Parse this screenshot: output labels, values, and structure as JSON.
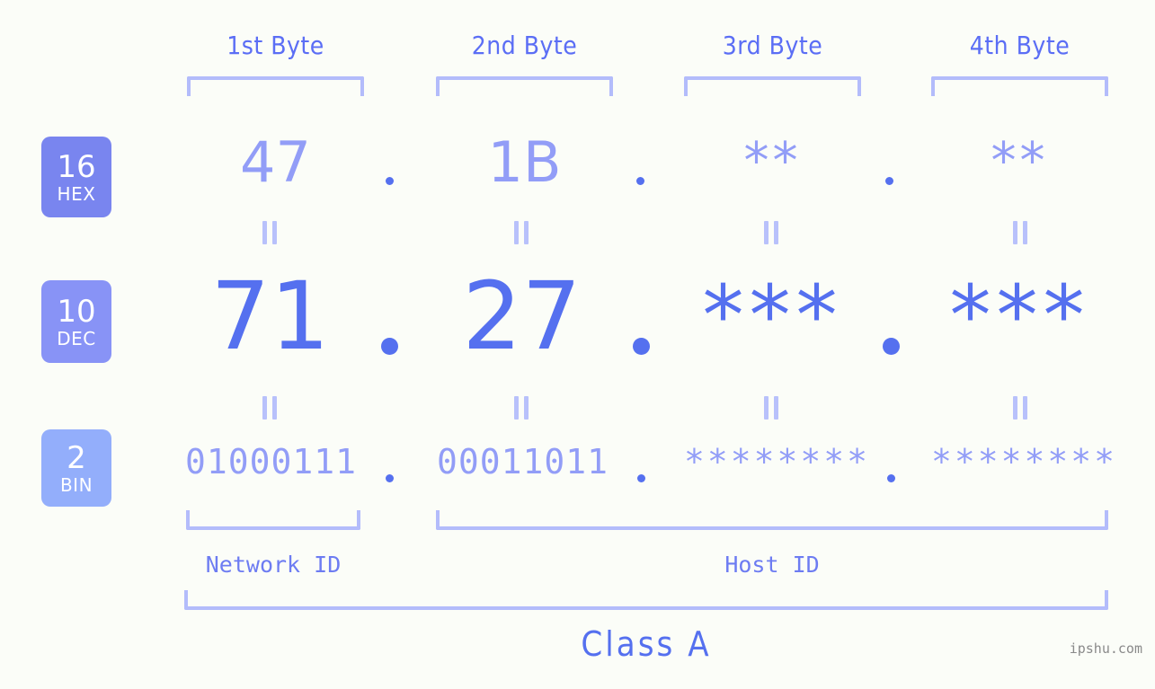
{
  "background_color": "#fbfdf8",
  "accent_color": "#5570ef",
  "accent_light": "#929df7",
  "bracket_color": "#b3bcfb",
  "byte_headers": [
    {
      "label": "1st Byte"
    },
    {
      "label": "2nd Byte"
    },
    {
      "label": "3rd Byte"
    },
    {
      "label": "4th Byte"
    }
  ],
  "bases": [
    {
      "number": "16",
      "word": "HEX",
      "color": "#7985ef"
    },
    {
      "number": "10",
      "word": "DEC",
      "color": "#8893f6"
    },
    {
      "number": "2",
      "word": "BIN",
      "color": "#93aefb"
    }
  ],
  "rows": {
    "hex": {
      "byte1": "47",
      "byte2": "1B",
      "byte3": "**",
      "byte4": "**",
      "separator": "."
    },
    "dec": {
      "byte1": "71",
      "byte2": "27",
      "byte3": "***",
      "byte4": "***",
      "separator": "."
    },
    "bin": {
      "byte1": "01000111",
      "byte2": "00011011",
      "byte3": "********",
      "byte4": "********",
      "separator": "."
    }
  },
  "segments": {
    "network_id": "Network ID",
    "host_id": "Host ID",
    "class": "Class A"
  },
  "watermark": "ipshu.com"
}
